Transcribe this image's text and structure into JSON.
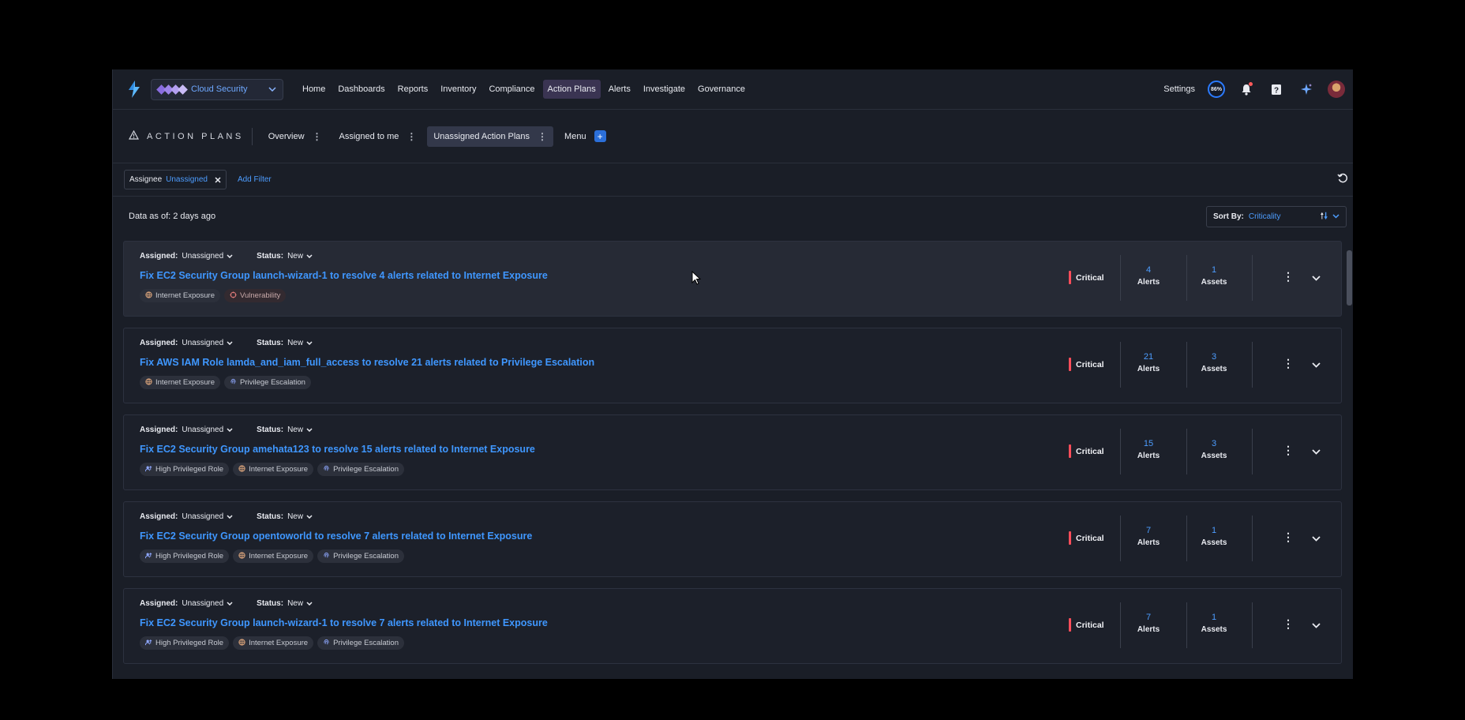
{
  "nav": {
    "product": "Cloud Security",
    "links": [
      "Home",
      "Dashboards",
      "Reports",
      "Inventory",
      "Compliance",
      "Action Plans",
      "Alerts",
      "Investigate",
      "Governance"
    ],
    "active_index": 5,
    "settings": "Settings",
    "score": "86%"
  },
  "subnav": {
    "title": "ACTION PLANS",
    "tabs": [
      "Overview",
      "Assigned to me",
      "Unassigned Action Plans"
    ],
    "menu_label": "Menu"
  },
  "filters": {
    "chip_key": "Assignee",
    "chip_value": "Unassigned",
    "add_filter": "Add Filter"
  },
  "data_as_of": "Data as of: 2 days ago",
  "sort": {
    "label": "Sort By:",
    "value": "Criticality"
  },
  "card_labels": {
    "assigned": "Assigned:",
    "status": "Status:",
    "alerts": "Alerts",
    "assets": "Assets"
  },
  "cards": [
    {
      "assigned": "Unassigned",
      "status": "New",
      "title": "Fix EC2 Security Group launch-wizard-1 to resolve 4 alerts related to Internet Exposure",
      "tags": [
        {
          "label": "Internet Exposure",
          "icon": "globe-icon"
        },
        {
          "label": "Vulnerability",
          "icon": "vulnerability-icon"
        }
      ],
      "criticality": "Critical",
      "alerts": "4",
      "assets": "1"
    },
    {
      "assigned": "Unassigned",
      "status": "New",
      "title": "Fix AWS IAM Role lamda_and_iam_full_access to resolve 21 alerts related to Privilege Escalation",
      "tags": [
        {
          "label": "Internet Exposure",
          "icon": "globe-icon"
        },
        {
          "label": "Privilege Escalation",
          "icon": "fingerprint-icon"
        }
      ],
      "criticality": "Critical",
      "alerts": "21",
      "assets": "3"
    },
    {
      "assigned": "Unassigned",
      "status": "New",
      "title": "Fix EC2 Security Group amehata123 to resolve 15 alerts related to Internet Exposure",
      "tags": [
        {
          "label": "High Privileged Role",
          "icon": "privileged-role-icon"
        },
        {
          "label": "Internet Exposure",
          "icon": "globe-icon"
        },
        {
          "label": "Privilege Escalation",
          "icon": "fingerprint-icon"
        }
      ],
      "criticality": "Critical",
      "alerts": "15",
      "assets": "3"
    },
    {
      "assigned": "Unassigned",
      "status": "New",
      "title": "Fix EC2 Security Group opentoworld to resolve 7 alerts related to Internet Exposure",
      "tags": [
        {
          "label": "High Privileged Role",
          "icon": "privileged-role-icon"
        },
        {
          "label": "Internet Exposure",
          "icon": "globe-icon"
        },
        {
          "label": "Privilege Escalation",
          "icon": "fingerprint-icon"
        }
      ],
      "criticality": "Critical",
      "alerts": "7",
      "assets": "1"
    },
    {
      "assigned": "Unassigned",
      "status": "New",
      "title": "Fix EC2 Security Group launch-wizard-1 to resolve 7 alerts related to Internet Exposure",
      "tags": [
        {
          "label": "High Privileged Role",
          "icon": "privileged-role-icon"
        },
        {
          "label": "Internet Exposure",
          "icon": "globe-icon"
        },
        {
          "label": "Privilege Escalation",
          "icon": "fingerprint-icon"
        }
      ],
      "criticality": "Critical",
      "alerts": "7",
      "assets": "1"
    }
  ],
  "colors": {
    "accent": "#3f97ff",
    "critical": "#ff4d5a",
    "background": "#1a1e27"
  }
}
